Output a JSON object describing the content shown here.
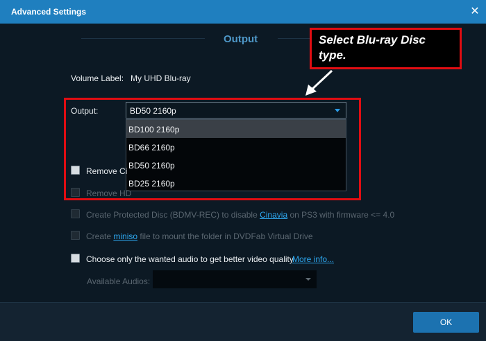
{
  "window": {
    "title": "Advanced Settings"
  },
  "section": {
    "title": "Output"
  },
  "volume": {
    "label": "Volume Label:",
    "value": "My UHD Blu-ray"
  },
  "output": {
    "label": "Output:",
    "selected": "BD50 2160p",
    "options": [
      "BD100 2160p",
      "BD66 2160p",
      "BD50 2160p",
      "BD25 2160p"
    ],
    "highlighted_index": 0
  },
  "options": {
    "remove_ci": "Remove Ci",
    "remove_hd": "Remove HD",
    "protected_pre": "Create Protected Disc (BDMV-REC) to disable ",
    "protected_link": "Cinavia",
    "protected_post": " on PS3 with firmware <= 4.0",
    "create_pre": "Create ",
    "create_link": "miniso",
    "create_post": " file to mount the folder in DVDFab Virtual Drive",
    "audio_only": "Choose only the wanted audio to get better video quality",
    "more_info": "More info..."
  },
  "audio": {
    "label": "Available Audios:",
    "value": ""
  },
  "footer": {
    "ok": "OK"
  },
  "callout": {
    "line1": "Select Blu-ray Disc",
    "line2": "type."
  },
  "colors": {
    "accent": "#1f7fbf",
    "highlight_red": "#e10d12",
    "link": "#2ea8f0"
  },
  "icons": {
    "close": "close-icon",
    "dropdown": "chevron-down-icon",
    "arrow": "pointer-arrow-icon"
  }
}
